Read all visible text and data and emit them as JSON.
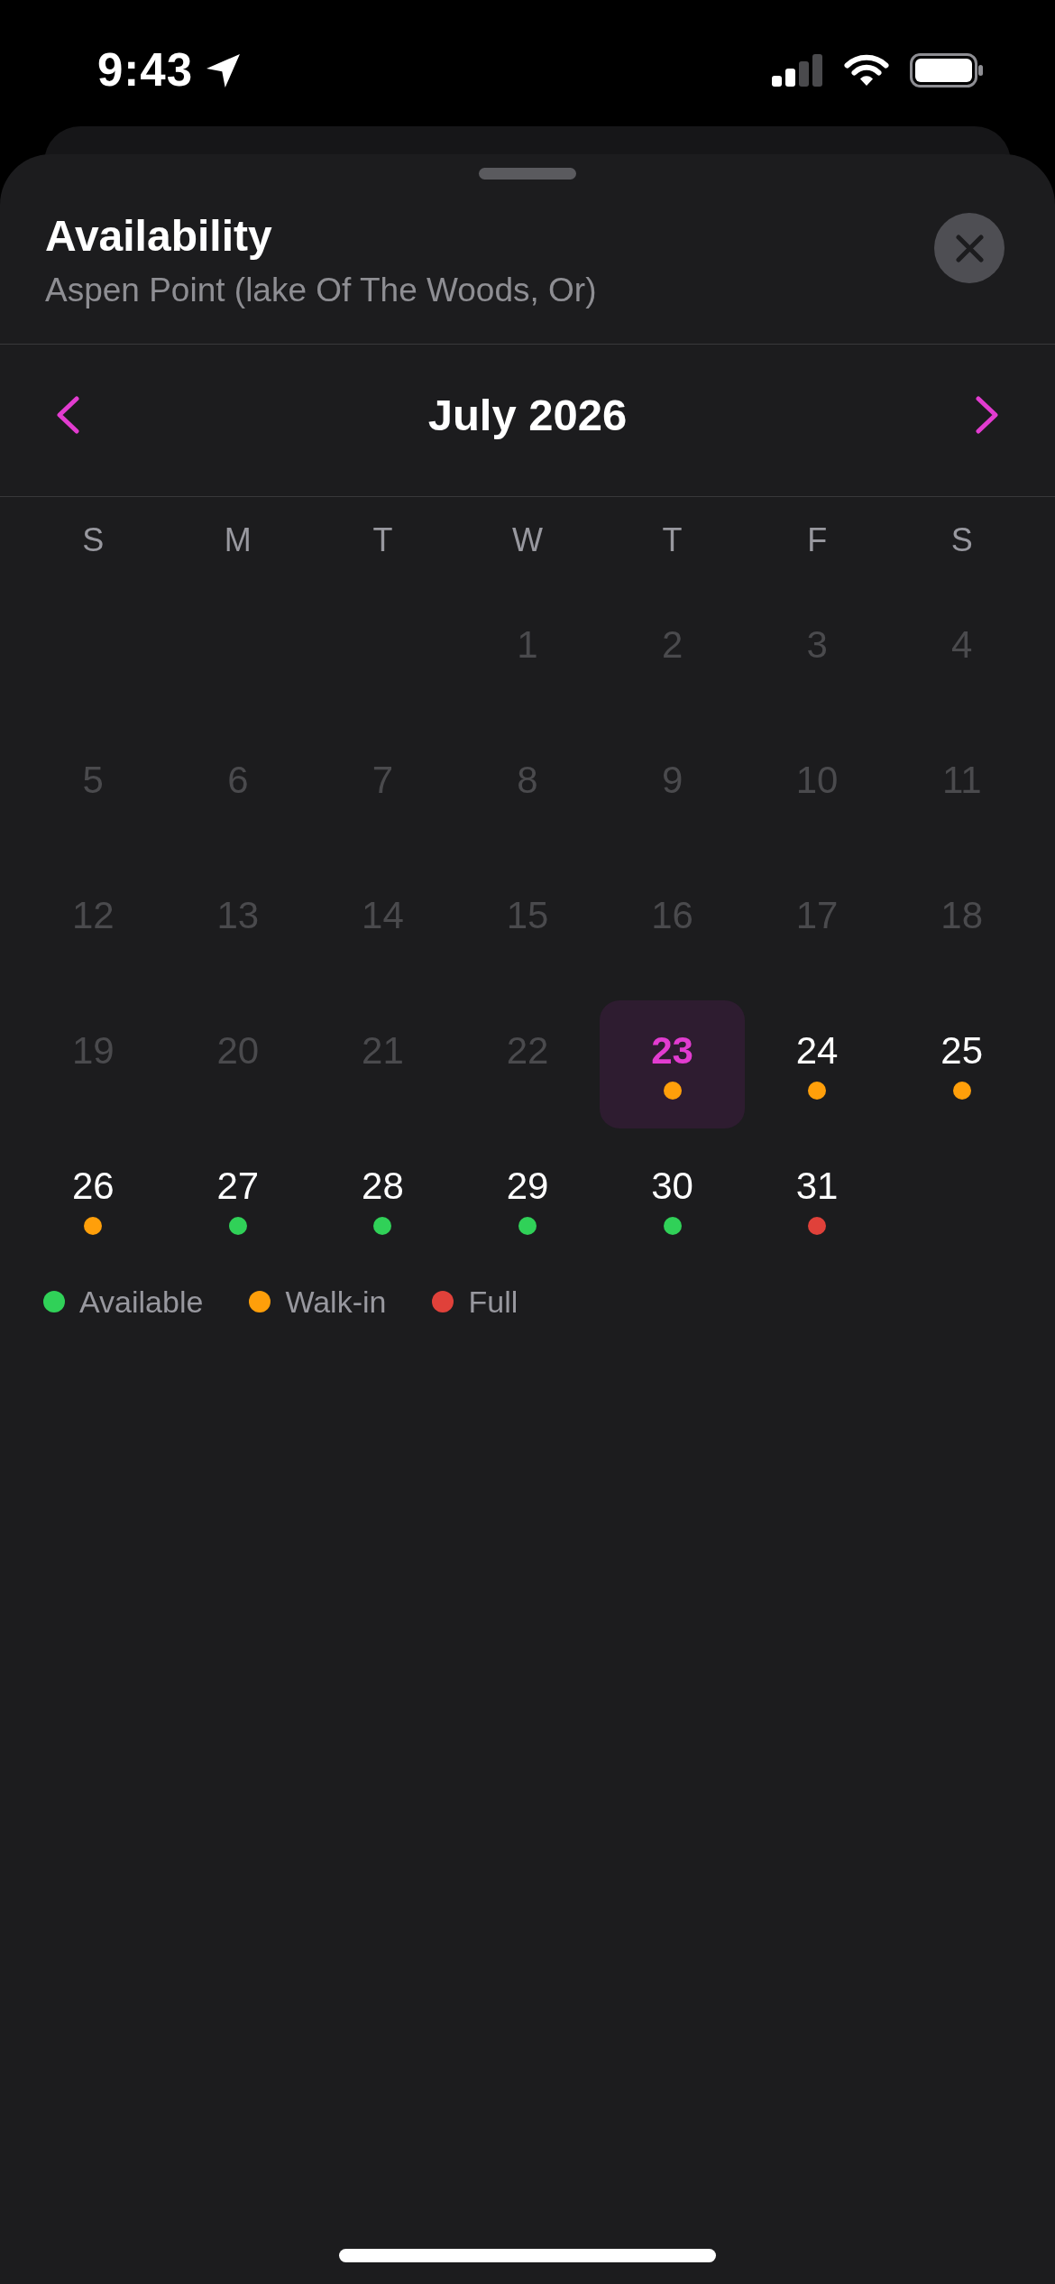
{
  "status_bar": {
    "time": "9:43"
  },
  "sheet": {
    "title": "Availability",
    "subtitle": "Aspen Point (lake Of The Woods, Or)"
  },
  "calendar": {
    "month": "July 2026",
    "weekdays": [
      "S",
      "M",
      "T",
      "W",
      "T",
      "F",
      "S"
    ],
    "weeks": [
      [
        {
          "day": "1",
          "disabled": true,
          "selected": false
        },
        {
          "day": "2",
          "disabled": true,
          "selected": false
        },
        {
          "day": "3",
          "disabled": true,
          "selected": false
        },
        {
          "day": "4",
          "disabled": true,
          "selected": false
        }
      ],
      [
        {
          "day": "5",
          "disabled": true,
          "selected": false
        },
        {
          "day": "6",
          "disabled": true,
          "selected": false
        },
        {
          "day": "7",
          "disabled": true,
          "selected": false
        },
        {
          "day": "8",
          "disabled": true,
          "selected": false
        },
        {
          "day": "9",
          "disabled": true,
          "selected": false
        },
        {
          "day": "10",
          "disabled": true,
          "selected": false
        },
        {
          "day": "11",
          "disabled": true,
          "selected": false
        }
      ],
      [
        {
          "day": "12",
          "disabled": true,
          "selected": false
        },
        {
          "day": "13",
          "disabled": true,
          "selected": false
        },
        {
          "day": "14",
          "disabled": true,
          "selected": false
        },
        {
          "day": "15",
          "disabled": true,
          "selected": false
        },
        {
          "day": "16",
          "disabled": true,
          "selected": false
        },
        {
          "day": "17",
          "disabled": true,
          "selected": false
        },
        {
          "day": "18",
          "disabled": true,
          "selected": false
        }
      ],
      [
        {
          "day": "19",
          "disabled": true,
          "selected": false
        },
        {
          "day": "20",
          "disabled": true,
          "selected": false
        },
        {
          "day": "21",
          "disabled": true,
          "selected": false
        },
        {
          "day": "22",
          "disabled": true,
          "selected": false
        },
        {
          "day": "23",
          "disabled": false,
          "selected": true,
          "color": "#ff9f0a"
        },
        {
          "day": "24",
          "disabled": false,
          "selected": false,
          "color": "#ff9f0a"
        },
        {
          "day": "25",
          "disabled": false,
          "selected": false,
          "color": "#ff9f0a"
        }
      ],
      [
        {
          "day": "26",
          "disabled": false,
          "selected": false,
          "color": "#ff9f0a"
        },
        {
          "day": "27",
          "disabled": false,
          "selected": false,
          "color": "#30d158"
        },
        {
          "day": "28",
          "disabled": false,
          "selected": false,
          "color": "#30d158"
        },
        {
          "day": "29",
          "disabled": false,
          "selected": false,
          "color": "#30d158"
        },
        {
          "day": "30",
          "disabled": false,
          "selected": false,
          "color": "#30d158"
        },
        {
          "day": "31",
          "disabled": false,
          "selected": false,
          "color": "#e0413a"
        }
      ]
    ]
  },
  "legend": [
    {
      "label": "Available",
      "color": "#30d158"
    },
    {
      "label": "Walk-in",
      "color": "#ff9f0a"
    },
    {
      "label": "Full",
      "color": "#e0413a"
    }
  ]
}
